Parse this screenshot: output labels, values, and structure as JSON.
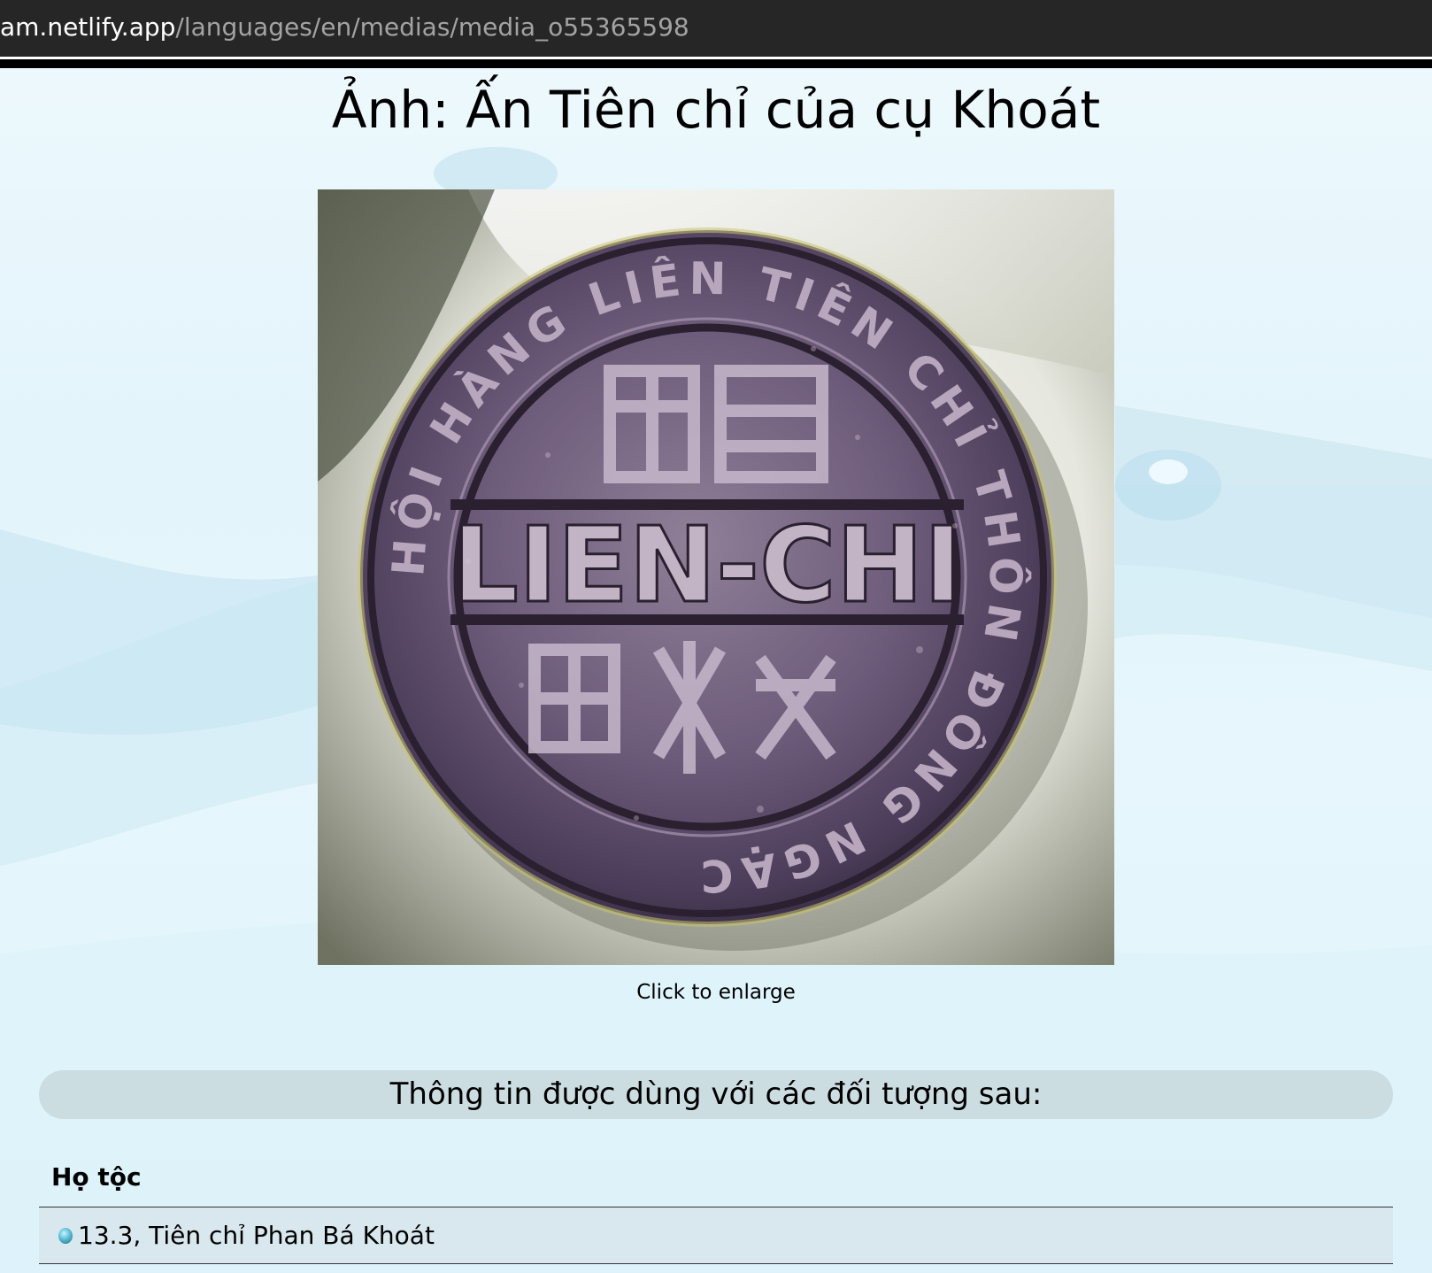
{
  "browser": {
    "url_host": "am.netlify.app",
    "url_path": "/languages/en/medias/media_o55365598"
  },
  "page": {
    "title": "Ảnh: Ấn Tiên chỉ của cụ Khoát",
    "image": {
      "alt": "Ảnh: Ấn Tiên chỉ của cụ Khoát",
      "seal_center_text": "LIEN-CHI",
      "seal_ring_text": "HỘI HÀNG LIÊN TIÊN CHỈ THÔN ĐÔNG NGẠC"
    },
    "caption": "Click to enlarge"
  },
  "section": {
    "heading": "Thông tin được dùng với các đối tượng sau:",
    "group_label": "Họ tộc",
    "items": [
      {
        "label": "13.3, Tiên chỉ Phan Bá Khoát",
        "icon": "globe-bullet-icon"
      }
    ]
  },
  "colors": {
    "address_bar": "#262626",
    "section_bar": "#ccdde2",
    "row_background": "#d9e8ee",
    "page_background": "#e6f6fc"
  }
}
